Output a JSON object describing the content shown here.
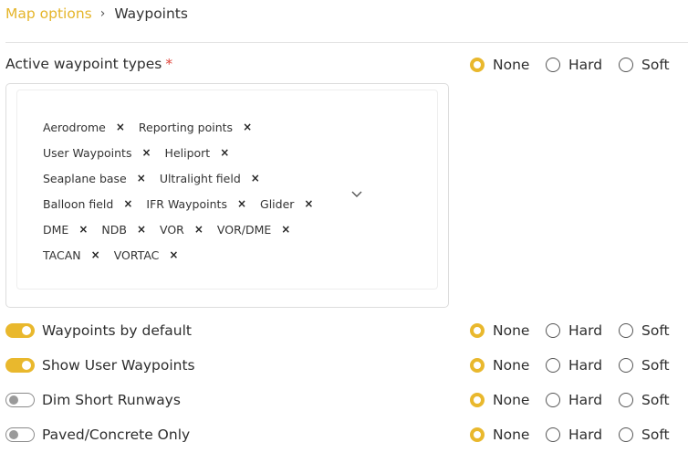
{
  "breadcrumb": {
    "parent": "Map options",
    "separator": "›",
    "current": "Waypoints"
  },
  "active_types": {
    "label": "Active waypoint types",
    "required_mark": "*",
    "tags": [
      [
        "Aerodrome",
        "Reporting points"
      ],
      [
        "User Waypoints",
        "Heliport"
      ],
      [
        "Seaplane base",
        "Ultralight field"
      ],
      [
        "Balloon field",
        "IFR Waypoints",
        "Glider"
      ],
      [
        "DME",
        "NDB",
        "VOR",
        "VOR/DME"
      ],
      [
        "TACAN",
        "VORTAC"
      ]
    ],
    "tag_remove_glyph": "×"
  },
  "radio_options": [
    "None",
    "Hard",
    "Soft"
  ],
  "radio_rows": [
    {
      "id": "active-waypoint-types",
      "selected": "None"
    },
    {
      "id": "waypoints-by-default",
      "selected": "None"
    },
    {
      "id": "show-user-waypoints",
      "selected": "None"
    },
    {
      "id": "dim-short-runways",
      "selected": "None"
    },
    {
      "id": "paved-concrete-only",
      "selected": "None"
    }
  ],
  "toggles": [
    {
      "label": "Waypoints by default",
      "on": true
    },
    {
      "label": "Show User Waypoints",
      "on": true
    },
    {
      "label": "Dim Short Runways",
      "on": false
    },
    {
      "label": "Paved/Concrete Only",
      "on": false
    }
  ],
  "colors": {
    "accent": "#e9b82d",
    "link": "#e5b52a",
    "required": "#e0453b"
  },
  "icons": {
    "dropdown": "chevron-down-icon",
    "breadcrumb_separator": "chevron-right-icon"
  }
}
